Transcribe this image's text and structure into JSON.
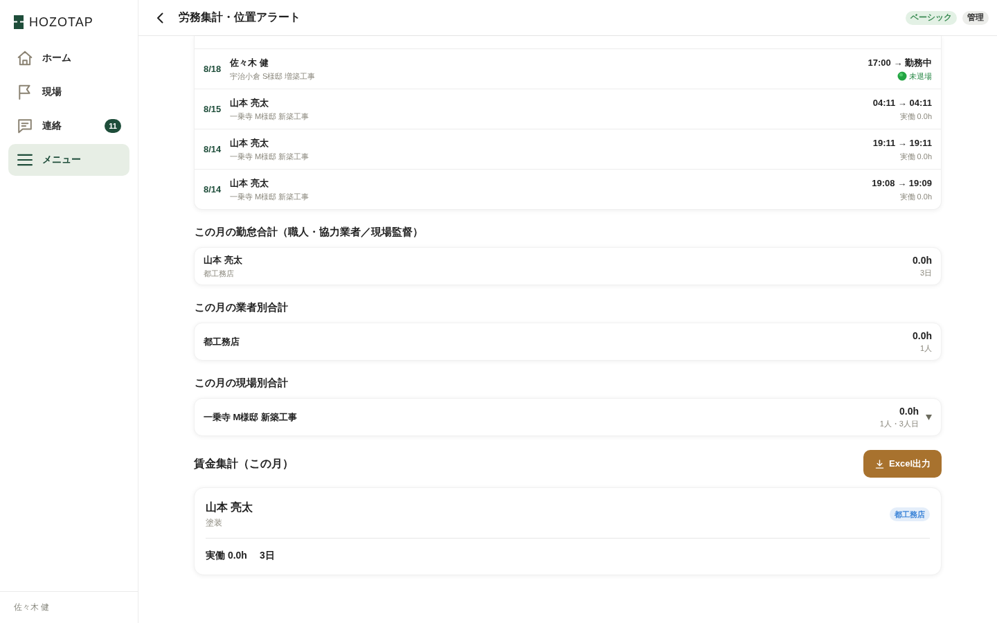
{
  "sidebar": {
    "logo": "HOZOTAP",
    "items": [
      {
        "label": "ホーム",
        "selected": false
      },
      {
        "label": "現場",
        "selected": false
      },
      {
        "label": "連絡",
        "selected": false,
        "badge": "11"
      },
      {
        "label": "メニュー",
        "selected": true
      }
    ],
    "user": "佐々木 健"
  },
  "header": {
    "title": "労務集計・位置アラート",
    "badges": [
      {
        "label": "ベーシック",
        "kind": "plan"
      },
      {
        "label": "管理",
        "kind": "role"
      }
    ]
  },
  "attendance_log": [
    {
      "date": "8/18",
      "name": "佐々木 健",
      "site": "宇治小倉 S様邸 増築工事",
      "time": "17:00 → 勤務中",
      "detail": "未退場",
      "kind": "working"
    },
    {
      "date": "8/15",
      "name": "山本 亮太",
      "site": "一乗寺 M様邸 新築工事",
      "time": "04:11 → 04:11",
      "detail": "実働 0.0h",
      "kind": "finished"
    },
    {
      "date": "8/14",
      "name": "山本 亮太",
      "site": "一乗寺 M様邸 新築工事",
      "time": "19:11 → 19:11",
      "detail": "実働 0.0h",
      "kind": "finished"
    },
    {
      "date": "8/14",
      "name": "山本 亮太",
      "site": "一乗寺 M様邸 新築工事",
      "time": "19:08 → 19:09",
      "detail": "実働 0.0h",
      "kind": "finished"
    }
  ],
  "monthly_by_worker": {
    "heading": "この月の勤怠合計（職人・協力業者／現場監督）",
    "rows": [
      {
        "name": "山本 亮太",
        "company": "都工務店",
        "hours": "0.0h",
        "count": "3日"
      }
    ]
  },
  "monthly_by_company": {
    "heading": "この月の業者別合計",
    "rows": [
      {
        "name": "都工務店",
        "hours": "0.0h",
        "count": "1人"
      }
    ]
  },
  "monthly_by_site": {
    "heading": "この月の現場別合計",
    "rows": [
      {
        "name": "一乗寺 M様邸 新築工事",
        "hours": "0.0h",
        "count": "1人・3人日",
        "expanded": false
      }
    ]
  },
  "wages": {
    "heading": "賃金集計（この月）",
    "export_button": "Excel出力",
    "rows": [
      {
        "name": "山本 亮太",
        "trade": "塗装",
        "company": "都工務店",
        "hours": "実働 0.0h",
        "days": "3日"
      }
    ]
  }
}
